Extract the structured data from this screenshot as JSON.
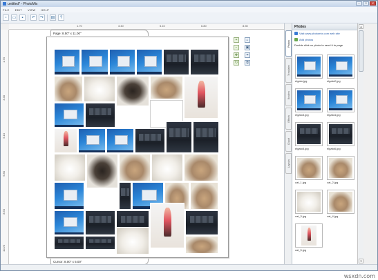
{
  "window": {
    "title": "untitled* - PhotoMix",
    "buttons": [
      "–",
      "□",
      "✕"
    ]
  },
  "menubar": {
    "items": [
      "FILE",
      "EDIT",
      "VIEW",
      "HELP"
    ]
  },
  "toolbar": {
    "icons": [
      "new-file-icon",
      "open-folder-icon",
      "save-icon",
      "undo-icon",
      "redo-icon",
      "print-icon",
      "help-icon"
    ]
  },
  "ruler": {
    "top_ticks": [
      "1.70",
      "3.40",
      "5.10",
      "6.80",
      "8.50"
    ],
    "left_ticks": [
      "1.70",
      "3.40",
      "5.10",
      "6.80",
      "8.50",
      "10.20"
    ]
  },
  "canvas": {
    "page_label": "Page: 8.50\" x 11.00\"",
    "cursor_label": "Cursor: 8.00\" x 5.00\""
  },
  "panel": {
    "title": "Photos",
    "visit_link": "Visit www.photomix.com web site",
    "add_link": "Add photos",
    "hint": "Double click on photo to send it to page",
    "tabs": [
      "Photos",
      "Templates",
      "Borders",
      "Effects",
      "Clipart",
      "Layouts"
    ],
    "thumbnails": [
      {
        "caption": "elgato.jpg",
        "kind": "desk"
      },
      {
        "caption": "elgato2.jpg",
        "kind": "desk"
      },
      {
        "caption": "elgato3.jpg",
        "kind": "desk"
      },
      {
        "caption": "elgato4.jpg",
        "kind": "desk"
      },
      {
        "caption": "elgato5.jpg",
        "kind": "dark"
      },
      {
        "caption": "elgato6.jpg",
        "kind": "dark"
      },
      {
        "caption": "cat_1.jpg",
        "kind": "cat"
      },
      {
        "caption": "cat_2.jpg",
        "kind": "cat"
      },
      {
        "caption": "cat_3.jpg",
        "kind": "catw"
      },
      {
        "caption": "cat_4.jpg",
        "kind": "cat"
      },
      {
        "caption": "cat_5.jpg",
        "kind": "girl"
      }
    ]
  },
  "watermark": "wsxdn.com",
  "colors": {
    "accent": "#3a7bd5",
    "link": "#2358a6",
    "float_tool_border": "#98b07f"
  }
}
